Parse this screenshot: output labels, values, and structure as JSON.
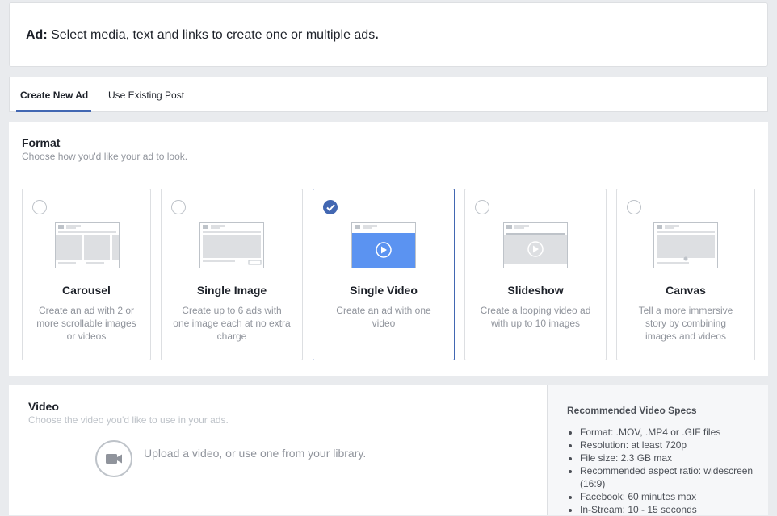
{
  "header": {
    "label": "Ad:",
    "text": " Select media, text and links to create one or multiple ads",
    "end": "."
  },
  "tabs": [
    {
      "label": "Create New Ad",
      "active": true
    },
    {
      "label": "Use Existing Post",
      "active": false
    }
  ],
  "format": {
    "title": "Format",
    "subtitle": "Choose how you'd like your ad to look.",
    "options": [
      {
        "title": "Carousel",
        "description": "Create an ad with 2 or more scrollable images or videos",
        "selected": false,
        "icon": "carousel-thumbnail-icon"
      },
      {
        "title": "Single Image",
        "description": "Create up to 6 ads with one image each at no extra charge",
        "selected": false,
        "icon": "single-image-thumbnail-icon"
      },
      {
        "title": "Single Video",
        "description": "Create an ad with one video",
        "selected": true,
        "icon": "single-video-thumbnail-icon"
      },
      {
        "title": "Slideshow",
        "description": "Create a looping video ad with up to 10 images",
        "selected": false,
        "icon": "slideshow-thumbnail-icon"
      },
      {
        "title": "Canvas",
        "description": "Tell a more immersive story by combining images and videos",
        "selected": false,
        "icon": "canvas-thumbnail-icon"
      }
    ]
  },
  "video": {
    "title": "Video",
    "subtitle": "Choose the video you'd like to use in your ads.",
    "upload_text": "Upload a video, or use one from your library.",
    "upload_icon": "video-camera-icon"
  },
  "specs": {
    "title": "Recommended Video Specs",
    "items": [
      "Format: .MOV, .MP4 or .GIF files",
      "Resolution: at least 720p",
      "File size: 2.3 GB max",
      "Recommended aspect ratio: widescreen (16:9)",
      "Facebook: 60 minutes max",
      "In-Stream: 10 - 15 seconds"
    ]
  },
  "colors": {
    "accent": "#4267b2",
    "muted": "#90949c",
    "selected_video": "#5b93f1"
  }
}
